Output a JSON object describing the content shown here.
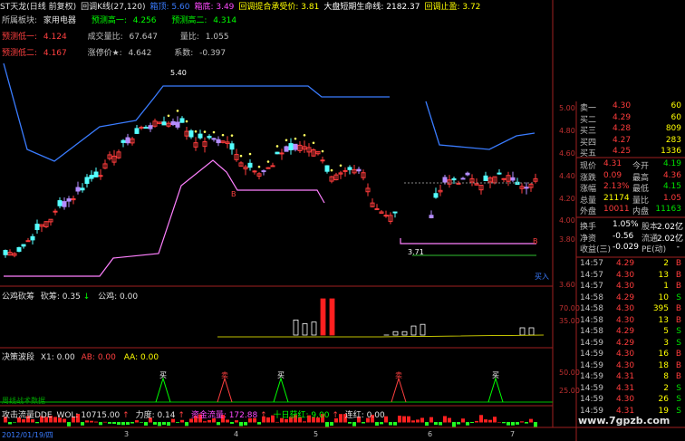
{
  "top_bar": [
    {
      "text": "ST天龙(日线 前复权)",
      "color": "#e0e0e0"
    },
    {
      "text": "回调K线(27,120)",
      "color": "#e0e0e0"
    },
    {
      "text": "箱顶: 5.60",
      "color": "#3a7cff"
    },
    {
      "text": "箱底: 3.49",
      "color": "#ff4aff"
    },
    {
      "text": "回调提合承受价: 3.81",
      "color": "#ffff00"
    },
    {
      "text": "大盘短期生命线: 2182.37",
      "color": "#ffffff"
    },
    {
      "text": "回调止盈: 3.72",
      "color": "#ffff00"
    }
  ],
  "info": {
    "sector_label": "所属板块:",
    "sector_value": "家用电器",
    "forecast_high1_label": "预测高一:",
    "forecast_high1_value": "4.256",
    "forecast_high2_label": "预测高二:",
    "forecast_high2_value": "4.314",
    "forecast_low1_label": "预测低一:",
    "forecast_low1_value": "4.124",
    "volume_ratio_label": "成交量比:",
    "volume_ratio_value": "67.647",
    "qty_ratio_label": "量比:",
    "qty_ratio_value": "1.055",
    "forecast_low2_label": "预测低二:",
    "forecast_low2_value": "4.167",
    "limit_up_label": "涨停价★:",
    "limit_up_value": "4.642",
    "coef_label": "系数:",
    "coef_value": "-0.397"
  },
  "price_annotations": {
    "peak": "5.40",
    "bottom": "3.71",
    "b1": "B",
    "b2": "B",
    "tag": "买入"
  },
  "y_ticks": [
    "5.00",
    "4.80",
    "4.60",
    "4.40",
    "4.20",
    "4.00",
    "3.80",
    "3.60"
  ],
  "panel2": {
    "title": "公鸡砍筹",
    "kan": "砍筹: 0.35",
    "gongji": "公鸡: 0.00",
    "ticks": [
      "70.00",
      "35.00"
    ]
  },
  "panel3": {
    "title": "决策波段",
    "x1": "X1: 0.00",
    "ab": "AB: 0.00",
    "aa": "AA: 0.00",
    "note": "周线战术数据",
    "ticks": [
      "50.00",
      "25.00"
    ],
    "signals": [
      "买",
      "卖",
      "买",
      "卖",
      "买"
    ]
  },
  "panel4": {
    "title": "攻击流量DDE",
    "wol": "WOL: 10715.00",
    "force": "力度: 0.14",
    "capital": "资金流量: 172.88",
    "ten_day": "十日获红: 9.00",
    "lianhong": "连红: 0.00"
  },
  "x_labels": [
    "2012/01/19/四",
    "3",
    "4",
    "5",
    "6",
    "7"
  ],
  "watermark": "www.7gpzb.com",
  "quote": {
    "order_book": [
      {
        "label": "卖一",
        "price": "4.30",
        "vol": "60",
        "pc": "#ff3c3c"
      },
      {
        "label": "买二",
        "price": "4.29",
        "vol": "60",
        "pc": "#ff3c3c"
      },
      {
        "label": "买三",
        "price": "4.28",
        "vol": "809",
        "pc": "#ff3c3c"
      },
      {
        "label": "买四",
        "price": "4.27",
        "vol": "283",
        "pc": "#ff3c3c"
      },
      {
        "label": "买五",
        "price": "4.25",
        "vol": "1336",
        "pc": "#ff3c3c"
      }
    ],
    "stats": [
      {
        "l1": "现价",
        "v1": "4.31",
        "c1": "#ff3c3c",
        "l2": "今开",
        "v2": "4.19",
        "c2": "#00e000"
      },
      {
        "l1": "涨跌",
        "v1": "0.09",
        "c1": "#ff3c3c",
        "l2": "最高",
        "v2": "4.36",
        "c2": "#ff3c3c"
      },
      {
        "l1": "涨幅",
        "v1": "2.13%",
        "c1": "#ff3c3c",
        "l2": "最低",
        "v2": "4.15",
        "c2": "#00e000"
      },
      {
        "l1": "总量",
        "v1": "21174",
        "c1": "#ffff00",
        "l2": "量比",
        "v2": "1.05",
        "c2": "#ff3c3c"
      },
      {
        "l1": "外盘",
        "v1": "10011",
        "c1": "#ff3c3c",
        "l2": "内盘",
        "v2": "11163",
        "c2": "#00e000"
      }
    ],
    "extra": [
      {
        "l1": "换手",
        "v1": "1.05%",
        "l2": "股本",
        "v2": "2.02亿"
      },
      {
        "l1": "净资",
        "v1": "-0.56",
        "l2": "流通",
        "v2": "2.02亿"
      }
    ],
    "pe_row": {
      "label": "收益(三)",
      "value": "-0.029",
      "label2": "PE(动)",
      "value2": "-"
    },
    "ticks": [
      {
        "time": "14:57",
        "price": "4.29",
        "vol": "2",
        "side": "B",
        "pc": "#ff3c3c",
        "sc": "#ff3c3c"
      },
      {
        "time": "14:57",
        "price": "4.30",
        "vol": "13",
        "side": "B",
        "pc": "#ff3c3c",
        "sc": "#ff3c3c"
      },
      {
        "time": "14:57",
        "price": "4.30",
        "vol": "1",
        "side": "B",
        "pc": "#ff3c3c",
        "sc": "#ff3c3c"
      },
      {
        "time": "14:58",
        "price": "4.29",
        "vol": "10",
        "side": "S",
        "pc": "#ff3c3c",
        "sc": "#00e000"
      },
      {
        "time": "14:58",
        "price": "4.30",
        "vol": "395",
        "side": "B",
        "pc": "#ff3c3c",
        "sc": "#ff3c3c"
      },
      {
        "time": "14:58",
        "price": "4.30",
        "vol": "13",
        "side": "B",
        "pc": "#ff3c3c",
        "sc": "#ff3c3c"
      },
      {
        "time": "14:58",
        "price": "4.29",
        "vol": "5",
        "side": "S",
        "pc": "#ff3c3c",
        "sc": "#00e000"
      },
      {
        "time": "14:59",
        "price": "4.29",
        "vol": "3",
        "side": "S",
        "pc": "#ff3c3c",
        "sc": "#00e000"
      },
      {
        "time": "14:59",
        "price": "4.30",
        "vol": "16",
        "side": "B",
        "pc": "#ff3c3c",
        "sc": "#ff3c3c"
      },
      {
        "time": "14:59",
        "price": "4.30",
        "vol": "18",
        "side": "B",
        "pc": "#ff3c3c",
        "sc": "#ff3c3c"
      },
      {
        "time": "14:59",
        "price": "4.31",
        "vol": "8",
        "side": "B",
        "pc": "#ff3c3c",
        "sc": "#ff3c3c"
      },
      {
        "time": "14:59",
        "price": "4.31",
        "vol": "2",
        "side": "S",
        "pc": "#ff3c3c",
        "sc": "#00e000"
      },
      {
        "time": "14:59",
        "price": "4.30",
        "vol": "26",
        "side": "S",
        "pc": "#ff3c3c",
        "sc": "#00e000"
      },
      {
        "time": "14:59",
        "price": "4.31",
        "vol": "19",
        "side": "S",
        "pc": "#ff3c3c",
        "sc": "#00e000"
      }
    ]
  }
}
